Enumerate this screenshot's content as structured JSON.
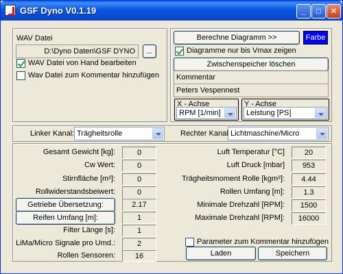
{
  "window": {
    "title": "GSF Dyno V0.1.19"
  },
  "wav_panel": {
    "label": "WAV Datei",
    "path_value": "D:\\Dyno Daten\\GSF DYNO",
    "browse_label": "...",
    "manual_edit_label": "WAV Datei von Hand bearbeiten",
    "manual_edit_checked": true,
    "add_to_comment_label": "Wav Datei zum Kommentar hinzufügen",
    "add_to_comment_checked": false
  },
  "diagram_panel": {
    "compute_label": "Berechne Diagramm >>",
    "color_label": "Farbe",
    "vmax_label": "Diagramme nur bis Vmax zeigen",
    "vmax_checked": true,
    "clear_cache_label": "Zwischenspeicher löschen",
    "comment_label": "Kommentar",
    "comment_value": "Peters Vespennest",
    "x_axis_label": "X - Achse",
    "x_axis_value": "RPM [1/min]",
    "y_axis_label": "Y - Achse",
    "y_axis_value": "Leistung [PS]"
  },
  "channels": {
    "left_label": "Linker Kanal:",
    "left_value": "Trägheitsrolle",
    "right_label": "Rechter Kanal:",
    "right_value": "Lichtmaschine/Micro"
  },
  "left_params": [
    {
      "label": "Gesamt Gewicht [kg]:",
      "value": "0",
      "is_button": false
    },
    {
      "label": "Cw Wert:",
      "value": "0",
      "is_button": false
    },
    {
      "label": "Stirnfläche [m²]:",
      "value": "0",
      "is_button": false
    },
    {
      "label": "Rollwiderstandsbeiwert:",
      "value": "0",
      "is_button": false
    },
    {
      "label": "Getriebe Übersetzung:",
      "value": "2.17",
      "is_button": true
    },
    {
      "label": "Reifen Umfang [m]:",
      "value": "1",
      "is_button": true
    },
    {
      "label": "Filter Länge [s]:",
      "value": "1",
      "is_button": false
    },
    {
      "label": "LiMa/Micro Signale pro Umd.:",
      "value": "2",
      "is_button": false
    },
    {
      "label": "Rollen Sensoren:",
      "value": "16",
      "is_button": false
    }
  ],
  "right_params": [
    {
      "label": "Luft Temperatur [°C]",
      "value": "20"
    },
    {
      "label": "Luft Druck [mbar]",
      "value": "953"
    },
    {
      "label": "Trägheitsmoment Rolle [kgm²]:",
      "value": "4.44"
    },
    {
      "label": "Rollen Umfang [m]:",
      "value": "1.3"
    },
    {
      "label": "Minimale Drehzahl [RPM]:",
      "value": "1500"
    },
    {
      "label": "Maximale Drehzahl [RPM]:",
      "value": "16000"
    }
  ],
  "footer": {
    "param_comment_label": "Parameter zum Kommentar hinzufügen",
    "param_comment_checked": false,
    "load_label": "Laden",
    "save_label": "Speichern"
  },
  "colors": {
    "title_bar": "#0a5fe8",
    "color_button": "#0000ff",
    "window_bg": "#ece9d8"
  }
}
